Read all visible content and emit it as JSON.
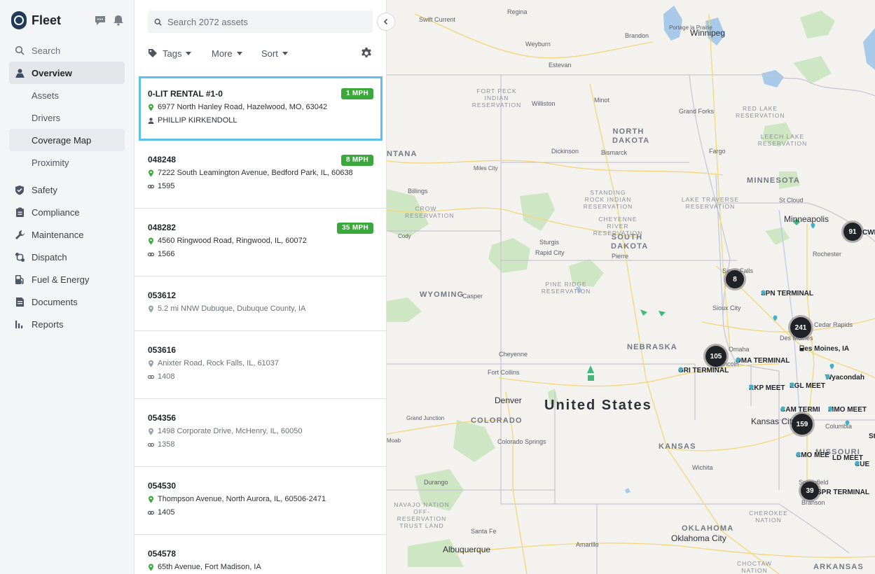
{
  "app": {
    "title": "Fleet"
  },
  "sidebar": {
    "items": [
      {
        "label": "Search",
        "icon": "search-icon"
      },
      {
        "label": "Overview",
        "icon": "overview-icon"
      },
      {
        "label": "Assets"
      },
      {
        "label": "Drivers"
      },
      {
        "label": "Coverage Map"
      },
      {
        "label": "Proximity"
      },
      {
        "label": "Safety",
        "icon": "shield-icon"
      },
      {
        "label": "Compliance",
        "icon": "clipboard-icon"
      },
      {
        "label": "Maintenance",
        "icon": "wrench-icon"
      },
      {
        "label": "Dispatch",
        "icon": "route-icon"
      },
      {
        "label": "Fuel & Energy",
        "icon": "fuel-icon"
      },
      {
        "label": "Documents",
        "icon": "document-icon"
      },
      {
        "label": "Reports",
        "icon": "bar-chart-icon"
      }
    ]
  },
  "list": {
    "search_placeholder": "Search 2072 assets",
    "toolbar": {
      "tags": "Tags",
      "more": "More",
      "sort": "Sort"
    },
    "assets": [
      {
        "name": "0-LIT RENTAL #1-0",
        "speed": "1 MPH",
        "address": "6977 North Hanley Road, Hazelwood, MO, 63042",
        "secondary": "PHILLIP KIRKENDOLL"
      },
      {
        "name": "048248",
        "speed": "8 MPH",
        "address": "7222 South Leamington Avenue, Bedford Park, IL, 60638",
        "secondary": "1595"
      },
      {
        "name": "048282",
        "speed": "35 MPH",
        "address": "4560 Ringwood Road, Ringwood, IL, 60072",
        "secondary": "1566"
      },
      {
        "name": "053612",
        "address": "5.2 mi NNW Dubuque, Dubuque County, IA"
      },
      {
        "name": "053616",
        "address": "Anixter Road, Rock Falls, IL, 61037",
        "secondary": "1408"
      },
      {
        "name": "054356",
        "address": "1498 Corporate Drive, McHenry, IL, 60050",
        "secondary": "1358"
      },
      {
        "name": "054530",
        "address": "Thompson Avenue, North Aurora, IL, 60506-2471",
        "secondary": "1405"
      },
      {
        "name": "054578",
        "address": "65th Avenue, Fort Madison, IA"
      }
    ]
  },
  "map": {
    "country": "United States",
    "states": [
      "NORTH DAKOTA",
      "SOUTH DAKOTA",
      "MINNESOTA",
      "NEBRASKA",
      "WYOMING",
      "COLORADO",
      "KANSAS",
      "OKLAHOMA",
      "ARKANSAS",
      "NTANA",
      "MISSOURI"
    ],
    "reservations": [
      "FORT PECK INDIAN RESERVATION",
      "RED LAKE RESERVATION",
      "LEECH LAKE RESERVATION",
      "STANDING ROCK INDIAN RESERVATION",
      "LAKE TRAVERSE RESERVATION",
      "CROW RESERVATION",
      "CHEYENNE RIVER RESERVATION",
      "PINE RIDGE RESERVATION",
      "NAVAJO NATION OFF-RESERVATION TRUST LAND",
      "CHEROKEE NATION",
      "CHOCTAW NATION"
    ],
    "cities": [
      "Regina",
      "Swift Current",
      "Brandon",
      "Portage la Prairie",
      "Winnipeg",
      "Weyburn",
      "Estevan",
      "Williston",
      "Minot",
      "Grand Forks",
      "Dickinson",
      "Bismarck",
      "Fargo",
      "Miles City",
      "Billings",
      "St Cloud",
      "Minneapolis",
      "Rochester",
      "Cody",
      "Sturgis",
      "Rapid City",
      "Pierre",
      "Sioux Falls",
      "Sioux City",
      "Casper",
      "Des Moines",
      "Cedar Rapids",
      "Cheyenne",
      "Omaha",
      "Lincoln",
      "Fort Collins",
      "Denver",
      "Grand Junction",
      "Colorado Springs",
      "Kansas City",
      "Columbia",
      "Wichita",
      "Springfield",
      "Branson",
      "Durango",
      "Santa Fe",
      "Albuquerque",
      "Amarillo",
      "Oklahoma City",
      "Moab",
      "Cedar Rapids"
    ],
    "clusters": [
      "91",
      "8",
      "241",
      "105",
      "159",
      "39"
    ],
    "terminals": [
      "SPN TERMINAL",
      "Des Moines, IA",
      "OMA TERMINAL",
      "GRI TERMINAL",
      "RKP MEET",
      "EGL MEET",
      "Wyacondah",
      "CAM TERMI",
      "MMO MEET",
      "CMO MEE",
      "LD MEET",
      "SPR TERMINAL",
      "CWI",
      "CUE",
      "St"
    ]
  }
}
